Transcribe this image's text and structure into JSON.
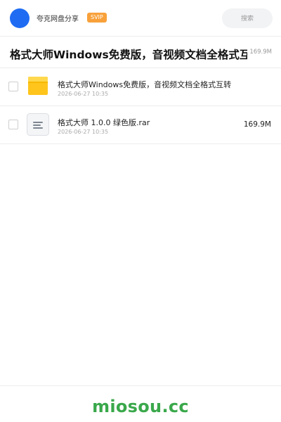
{
  "header": {
    "username": "夸克网盘分享",
    "badge": "SVIP",
    "search_label": "搜索"
  },
  "share": {
    "title": "格式大师Windows免费版，音视频文档全格式互转",
    "size": "169.9M"
  },
  "files": [
    {
      "name": "格式大师Windows免费版，音视频文档全格式互转",
      "date": "2026-06-27 10:35",
      "size": "",
      "icon": "folder-icon"
    },
    {
      "name": "格式大师 1.0.0 绿色版.rar",
      "date": "2026-06-27 10:35",
      "size": "169.9M",
      "icon": "archive-file-icon"
    }
  ],
  "footer": {
    "brand": "miosou.cc"
  },
  "colors": {
    "avatar": "#1f6cf3",
    "badge": "#f8a13a",
    "folder": "#ffc51c",
    "brand": "#3aa84b"
  }
}
